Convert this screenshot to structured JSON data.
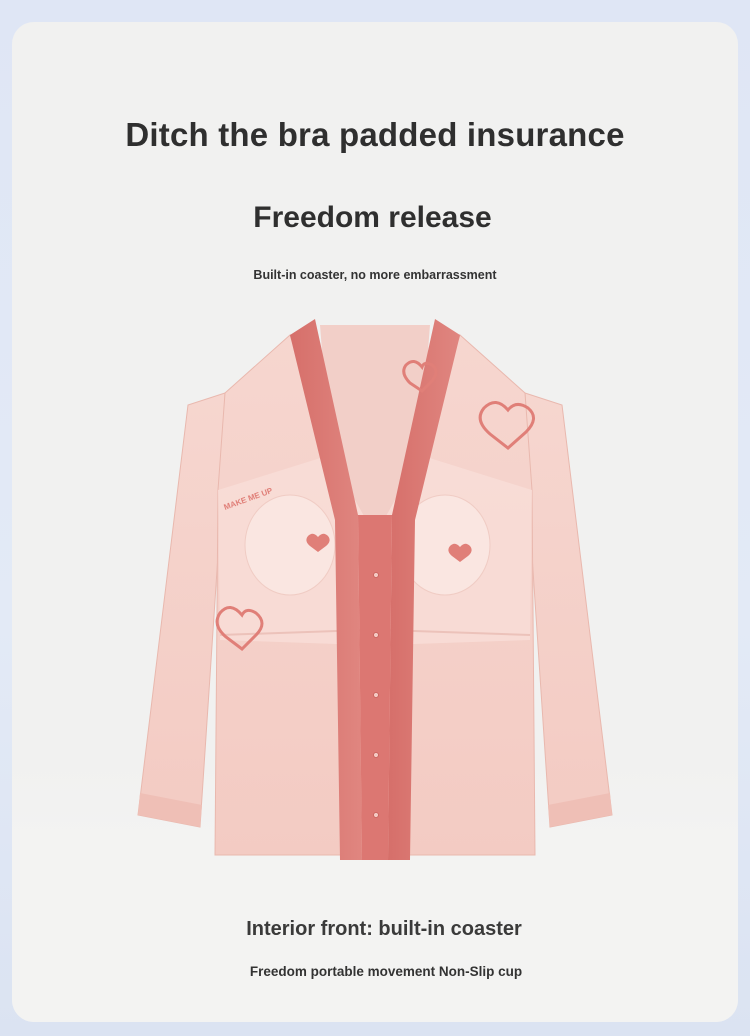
{
  "headline": "Ditch the bra padded insurance",
  "subheadline": "Freedom release",
  "tagline": "Built-in coaster, no more embarrassment",
  "product": {
    "garment_print_text": "MAKE ME UP",
    "colors": {
      "body": "#f5cfc8",
      "trim": "#d9716c",
      "heart": "#e07f78"
    }
  },
  "caption": {
    "title": "Interior front: built-in coaster",
    "subtitle": "Freedom portable movement Non-Slip cup"
  }
}
